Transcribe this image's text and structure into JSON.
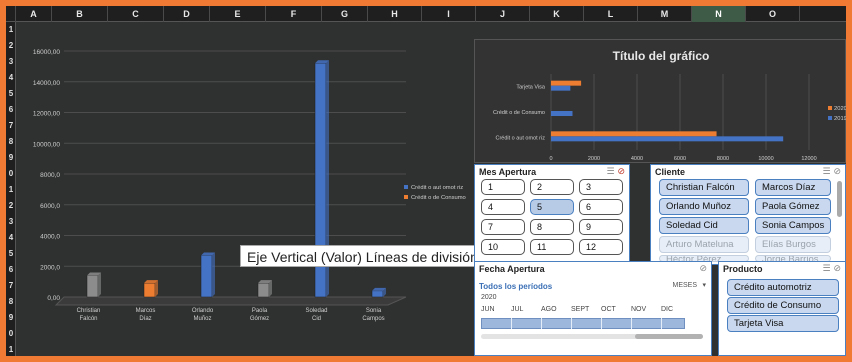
{
  "columns": [
    "A",
    "B",
    "C",
    "D",
    "E",
    "F",
    "G",
    "H",
    "I",
    "J",
    "K",
    "L",
    "M",
    "N",
    "O"
  ],
  "selected_column": "N",
  "row_numbers": [
    "1",
    "2",
    "3",
    "4",
    "5",
    "6",
    "7",
    "8",
    "9",
    "0",
    "1",
    "2",
    "3",
    "4",
    "5",
    "6",
    "7",
    "8",
    "9",
    "0",
    "1"
  ],
  "tooltip": "Eje Vertical (Valor)  Líneas de división principales",
  "chart_data": [
    {
      "type": "bar",
      "title": "",
      "categories": [
        "Christian Falcón",
        "Marcos Díaz",
        "Orlando Muñoz",
        "Paola Gómez",
        "Soledad Cid",
        "Sonia Campos"
      ],
      "series": [
        {
          "name": "Crédito automotriz",
          "values": [
            0,
            0,
            2700,
            0,
            15200,
            400
          ],
          "color": "#4472c4"
        },
        {
          "name": "Crédito de Consumo",
          "values": [
            0,
            900,
            0,
            0,
            0,
            0
          ],
          "color": "#ed7d31"
        },
        {
          "name": "",
          "values": [
            1400,
            0,
            0,
            900,
            0,
            0
          ],
          "color": "#8c8c8c"
        }
      ],
      "ytick_labels": [
        "0,00",
        "2000,0",
        "4000,0",
        "6000,0",
        "8000,0",
        "10000,00",
        "12000,00",
        "14000,00",
        "16000,00"
      ],
      "ylim": [
        0,
        16000
      ],
      "grid": true,
      "legend": "right",
      "legend_labels": [
        "Crédit o aut omot riz",
        "Crédit o de Consumo"
      ]
    },
    {
      "type": "bar",
      "orientation": "horizontal",
      "title": "Título del gráfico",
      "categories": [
        "Tarjeta Visa",
        "Crédit o de Consumo",
        "Crédit o aut omot riz"
      ],
      "series": [
        {
          "name": "2020",
          "values": [
            1400,
            0,
            7700
          ],
          "color": "#ed7d31"
        },
        {
          "name": "2019",
          "values": [
            900,
            1000,
            10800
          ],
          "color": "#4472c4"
        }
      ],
      "xtick_labels": [
        "0",
        "2000",
        "4000",
        "6000",
        "8000",
        "10000",
        "12000"
      ],
      "xlim": [
        0,
        12000
      ],
      "grid": true,
      "legend": "right"
    }
  ],
  "slicers": {
    "mes": {
      "title": "Mes Apertura",
      "items": [
        "1",
        "2",
        "3",
        "4",
        "5",
        "6",
        "7",
        "8",
        "9",
        "10",
        "11",
        "12"
      ],
      "selected": [
        "5"
      ]
    },
    "cliente": {
      "title": "Cliente",
      "items": [
        "Christian Falcón",
        "Marcos Díaz",
        "Orlando Muñoz",
        "Paola Gómez",
        "Soledad Cid",
        "Sonia Campos",
        "Arturo Mateluna",
        "Elías Burgos",
        "Héctor Pérez",
        "Jorge Barrios"
      ]
    },
    "fecha": {
      "title": "Fecha Apertura",
      "period_label": "Todos los períodos",
      "unit_label": "MESES",
      "year": "2020",
      "months": [
        "JUN",
        "JUL",
        "AGO",
        "SEPT",
        "OCT",
        "NOV",
        "DIC"
      ]
    },
    "producto": {
      "title": "Producto",
      "items": [
        "Crédito automotriz",
        "Crédito de Consumo",
        "Tarjeta Visa"
      ]
    }
  },
  "icons": {
    "multiselect": "multi-select-icon",
    "clear_filter": "clear-filter-icon",
    "dropdown": "dropdown-arrow-icon"
  }
}
